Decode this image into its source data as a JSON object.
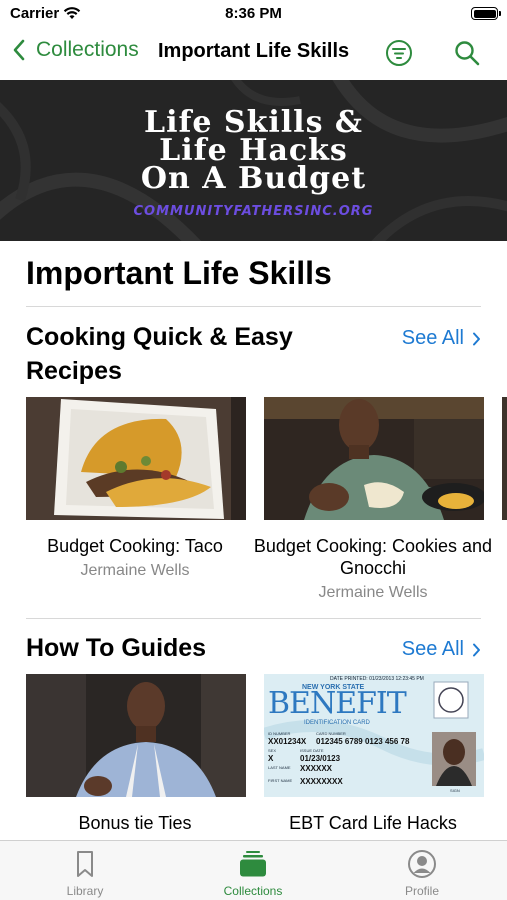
{
  "status_bar": {
    "carrier": "Carrier",
    "time": "8:36 PM"
  },
  "nav": {
    "back_label": "Collections",
    "title": "Important Life Skills",
    "accent_color": "#2e8b3e"
  },
  "banner": {
    "line1": "Life Skills &",
    "line2": "Life Hacks",
    "line3": "On A Budget",
    "url": "COMMUNITYFATHERSINC.ORG"
  },
  "page": {
    "heading": "Important Life Skills"
  },
  "sections": [
    {
      "title": "Cooking Quick & Easy Recipes",
      "see_all": "See All",
      "items": [
        {
          "title": "Budget Cooking: Taco",
          "author": "Jermaine Wells"
        },
        {
          "title": "Budget Cooking: Cookies and Gnocchi",
          "author": "Jermaine Wells"
        }
      ]
    },
    {
      "title": "How To Guides",
      "see_all": "See All",
      "items": [
        {
          "title": "Bonus tie Ties",
          "author": ""
        },
        {
          "title": "EBT Card Life Hacks",
          "author": "",
          "card": {
            "date_printed": "DATE PRINTED: 01/23/2013 12:23:45 PM",
            "state": "NEW YORK STATE",
            "brand": "BENEFIT",
            "subtitle": "IDENTIFICATION CARD",
            "id_label": "ID NUMBER",
            "id_number": "XX01234X",
            "card_label": "CARD NUMBER",
            "card_number": "012345 6789 0123 456 78",
            "sex_label": "SEX",
            "sex": "X",
            "issue_label": "ISSUE DATE",
            "issue_date": "01/23/0123",
            "last_label": "LAST NAME",
            "last_name": "XXXXXX",
            "first_label": "FIRST NAME",
            "first_name": "XXXXXXXX",
            "sig_label": "SIGN"
          }
        }
      ]
    }
  ],
  "tab_bar": {
    "tabs": [
      {
        "label": "Library",
        "icon": "bookmark-icon"
      },
      {
        "label": "Collections",
        "icon": "collections-icon"
      },
      {
        "label": "Profile",
        "icon": "profile-icon"
      }
    ],
    "active_color": "#2e8b3e",
    "inactive_color": "#8a8a8a"
  }
}
